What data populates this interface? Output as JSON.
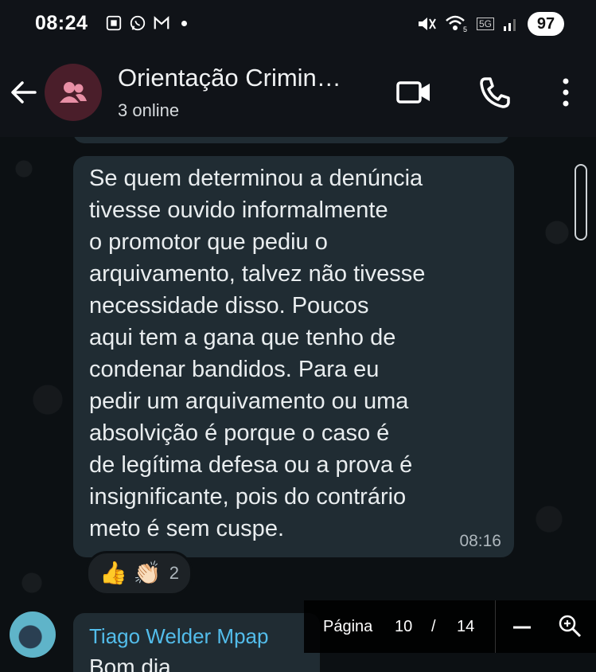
{
  "status_bar": {
    "time": "08:24",
    "battery": "97",
    "network": "5G"
  },
  "header": {
    "title": "Orientação Crimin…",
    "subtitle": "3 online",
    "avatar_icon": "group-icon",
    "colors": {
      "background": "#101318",
      "avatar_bg": "#4a1e2a",
      "avatar_fg": "#e88fa5"
    }
  },
  "messages": [
    {
      "text": "Se quem determinou a denúncia\ntivesse ouvido informalmente\no promotor que pediu o\narquivamento, talvez não tivesse\nnecessidade disso. Poucos\naqui tem a gana que tenho de\ncondenar bandidos. Para eu\npedir um arquivamento ou uma\nabsolvição é porque o caso é\nde legítima defesa ou a prova é\ninsignificante, pois do contrário\nmeto é sem cuspe.",
      "time": "08:16",
      "reactions": {
        "emojis": [
          "👍",
          "👏🏻"
        ],
        "count": "2"
      }
    },
    {
      "sender": "Tiago Welder Mpap",
      "text": "Bom dia"
    }
  ],
  "pager": {
    "label": "Página",
    "current": "10",
    "separator": "/",
    "total": "14"
  },
  "colors": {
    "bubble": "#202c33",
    "sender_name": "#53bdeb",
    "chat_bg": "#0c1013"
  }
}
